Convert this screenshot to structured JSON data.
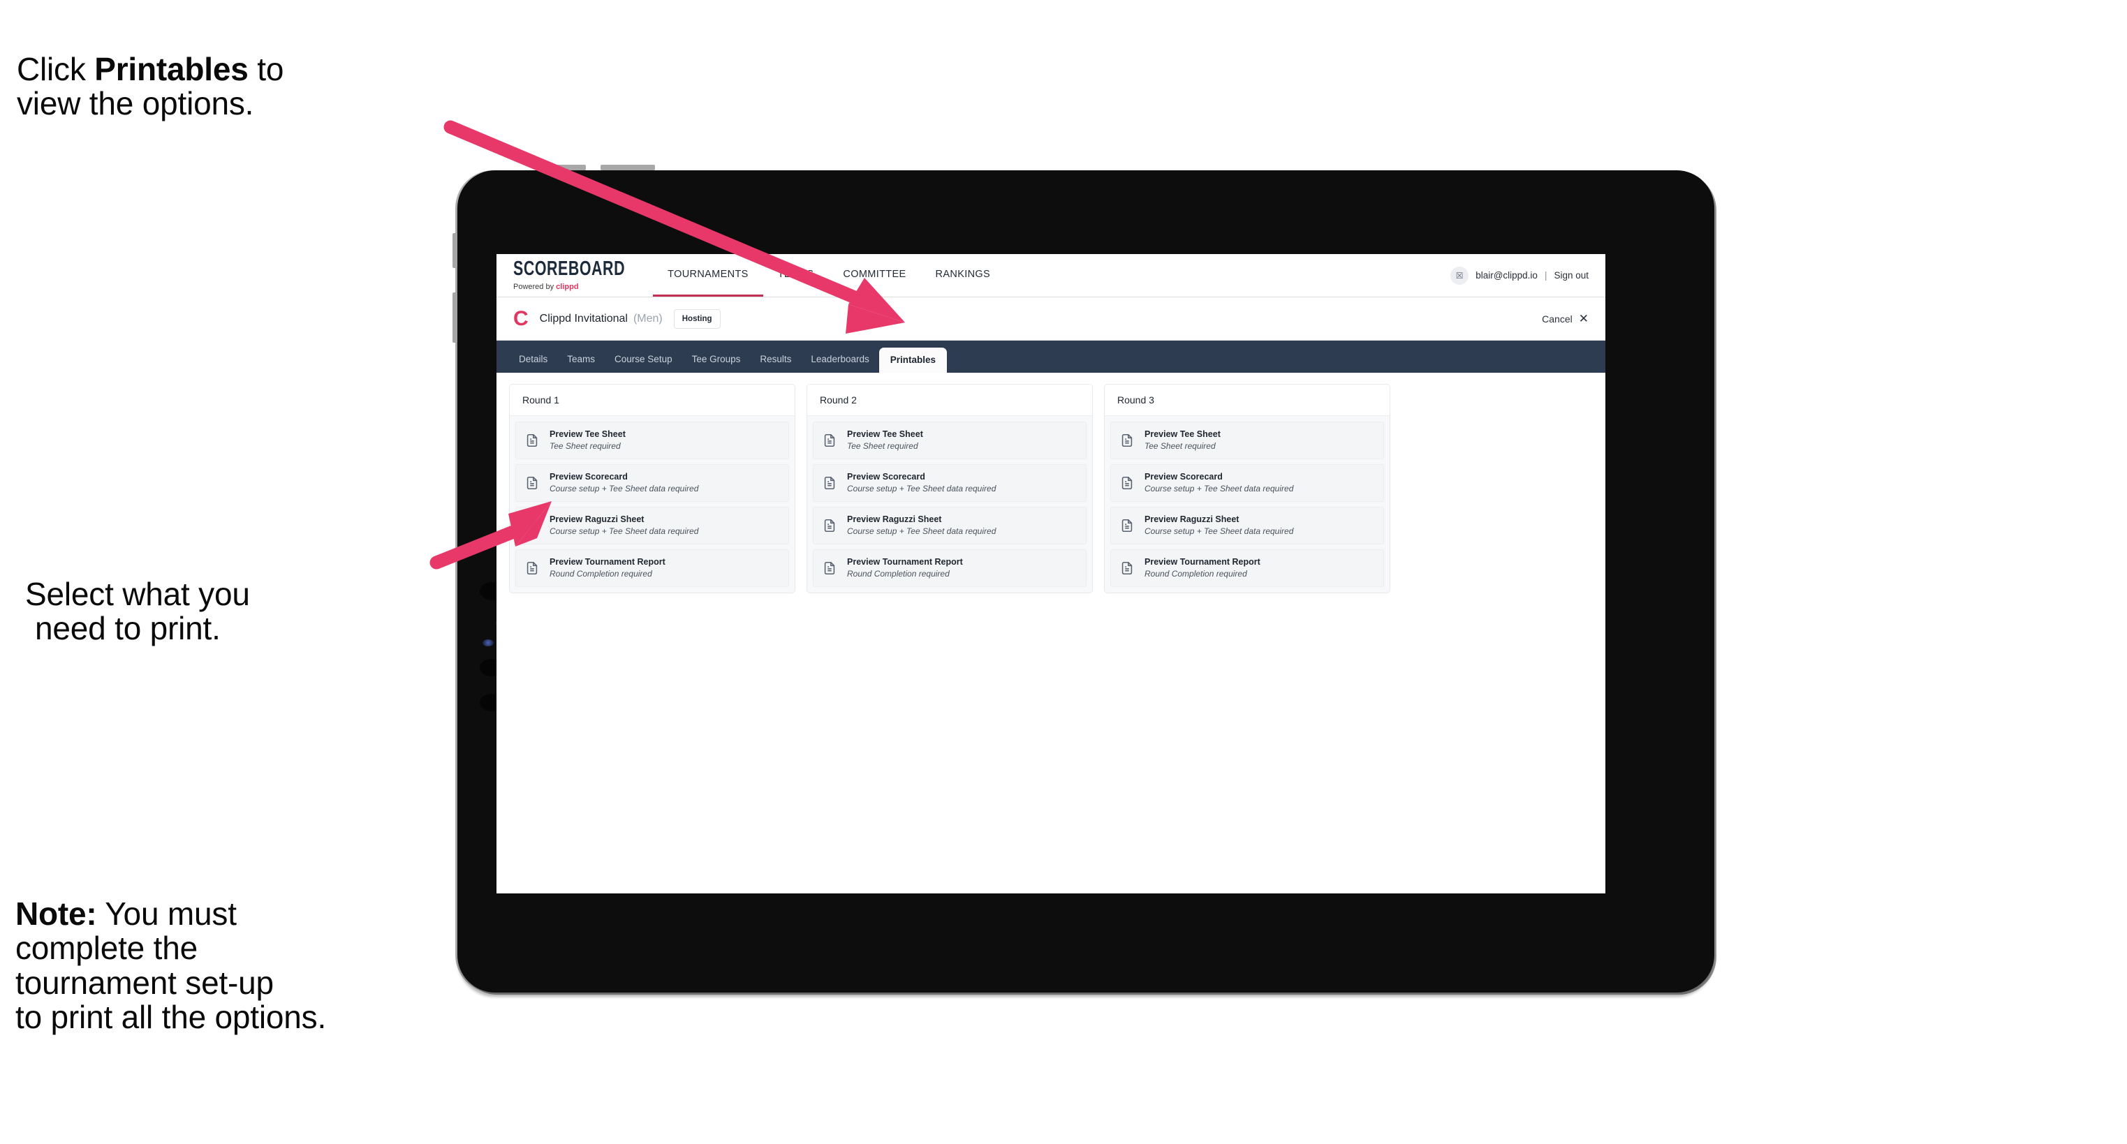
{
  "annotations": {
    "callout_1": {
      "pre": "Click ",
      "bold": "Printables",
      "post": " to\nview the options."
    },
    "callout_2_line1": "Select what you",
    "callout_2_line2": "need to print.",
    "callout_3": {
      "bold": "Note:",
      "text": " You must\ncomplete the\ntournament set-up\nto print all the options."
    },
    "arrow_color": "#E8386A"
  },
  "app": {
    "brand": {
      "word": "SCOREBOARD",
      "powered_prefix": "Powered by ",
      "powered_brand": "clippd"
    },
    "top_nav": [
      {
        "label": "TOURNAMENTS",
        "active": true
      },
      {
        "label": "TEAMS",
        "active": false
      },
      {
        "label": "COMMITTEE",
        "active": false
      },
      {
        "label": "RANKINGS",
        "active": false
      }
    ],
    "account": {
      "avatar_glyph": "☒",
      "email": "blair@clippd.io",
      "separator": "|",
      "sign_out": "Sign out"
    },
    "tournament": {
      "logo_letter": "C",
      "name": "Clippd Invitational",
      "gender": "(Men)",
      "status_chip": "Hosting",
      "cancel_label": "Cancel",
      "cancel_icon": "✕"
    },
    "tabs": [
      {
        "label": "Details",
        "active": false
      },
      {
        "label": "Teams",
        "active": false
      },
      {
        "label": "Course Setup",
        "active": false
      },
      {
        "label": "Tee Groups",
        "active": false
      },
      {
        "label": "Results",
        "active": false
      },
      {
        "label": "Leaderboards",
        "active": false
      },
      {
        "label": "Printables",
        "active": true
      }
    ],
    "rounds": [
      {
        "title": "Round 1",
        "items": [
          {
            "title": "Preview Tee Sheet",
            "subtitle": "Tee Sheet required"
          },
          {
            "title": "Preview Scorecard",
            "subtitle": "Course setup + Tee Sheet data required"
          },
          {
            "title": "Preview Raguzzi Sheet",
            "subtitle": "Course setup + Tee Sheet data required"
          },
          {
            "title": "Preview Tournament Report",
            "subtitle": "Round Completion required"
          }
        ]
      },
      {
        "title": "Round 2",
        "items": [
          {
            "title": "Preview Tee Sheet",
            "subtitle": "Tee Sheet required"
          },
          {
            "title": "Preview Scorecard",
            "subtitle": "Course setup + Tee Sheet data required"
          },
          {
            "title": "Preview Raguzzi Sheet",
            "subtitle": "Course setup + Tee Sheet data required"
          },
          {
            "title": "Preview Tournament Report",
            "subtitle": "Round Completion required"
          }
        ]
      },
      {
        "title": "Round 3",
        "items": [
          {
            "title": "Preview Tee Sheet",
            "subtitle": "Tee Sheet required"
          },
          {
            "title": "Preview Scorecard",
            "subtitle": "Course setup + Tee Sheet data required"
          },
          {
            "title": "Preview Raguzzi Sheet",
            "subtitle": "Course setup + Tee Sheet data required"
          },
          {
            "title": "Preview Tournament Report",
            "subtitle": "Round Completion required"
          }
        ]
      }
    ],
    "colors": {
      "nav_bar": "#2E3C52",
      "brand_pink": "#E2355F",
      "active_underline": "#C42F56"
    }
  }
}
